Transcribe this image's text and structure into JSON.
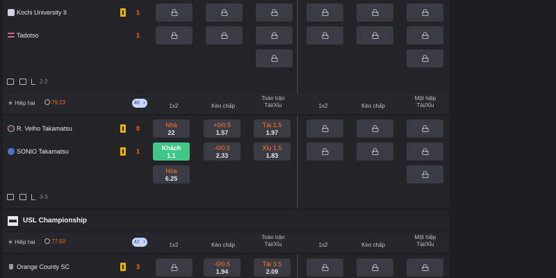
{
  "match1": {
    "home": "Kochi University II",
    "away": "Tadotso",
    "home_score": "1",
    "away_score": "1",
    "ft_score": "2-2"
  },
  "match2": {
    "period": "Hiệp hai",
    "clock": "79:23",
    "more_count": "46",
    "home": "R. Velho Takamatsu",
    "away": "SONIO Takamatsu",
    "home_score": "0",
    "away_score": "1",
    "ft_score": "3-3",
    "odds": {
      "home_1x2_label": "Nhà",
      "home_1x2_value": "22",
      "away_1x2_label": "Khách",
      "away_1x2_value": "1.1",
      "draw_label": "Hòa",
      "draw_value": "6.25",
      "hcp_home_line": "+0/0.5",
      "hcp_home_value": "1.57",
      "hcp_away_line": "-0/0.5",
      "hcp_away_value": "2.33",
      "ou_over_line": "Tài 1.5",
      "ou_over_value": "1.97",
      "ou_under_line": "Xỉu 1.5",
      "ou_under_value": "1.83"
    }
  },
  "columns": {
    "c1": "1x2",
    "c2": "Kèo chấp",
    "c3_line1": "Toàn trận",
    "c3_line2": "Tài/Xỉu",
    "c4": "1x2",
    "c5": "Kèo chấp",
    "c6_line1": "Một hiệp",
    "c6_line2": "Tài/Xỉu"
  },
  "league": {
    "name": "USL Championship"
  },
  "match3": {
    "period": "Hiệp hai",
    "clock": "77:50",
    "more_count": "42",
    "home": "Orange County SC",
    "home_score": "3",
    "hcp_line": "-0/0.5",
    "hcp_value": "1.94",
    "ou_line": "Tài 3.5",
    "ou_value": "2.09"
  },
  "colors": {
    "accent_orange": "#ff6a1f",
    "active_green": "#3ec786",
    "cell_bg": "#3b3b44"
  }
}
